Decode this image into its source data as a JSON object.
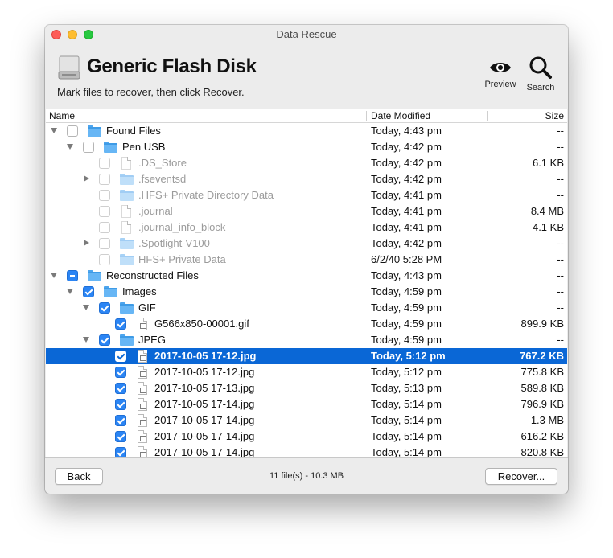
{
  "window": {
    "title": "Data Rescue"
  },
  "header": {
    "disk_title": "Generic Flash Disk",
    "subtitle": "Mark files to recover, then click Recover.",
    "preview_label": "Preview",
    "search_label": "Search"
  },
  "columns": {
    "name": "Name",
    "date": "Date Modified",
    "size": "Size"
  },
  "rows": [
    {
      "name": "Found Files",
      "date": "Today, 4:43 pm",
      "size": "--"
    },
    {
      "name": "Pen USB",
      "date": "Today, 4:42 pm",
      "size": "--"
    },
    {
      "name": ".DS_Store",
      "date": "Today, 4:42 pm",
      "size": "6.1 KB"
    },
    {
      "name": ".fseventsd",
      "date": "Today, 4:42 pm",
      "size": "--"
    },
    {
      "name": ".HFS+ Private Directory Data",
      "date": "Today, 4:41 pm",
      "size": "--"
    },
    {
      "name": ".journal",
      "date": "Today, 4:41 pm",
      "size": "8.4 MB"
    },
    {
      "name": ".journal_info_block",
      "date": "Today, 4:41 pm",
      "size": "4.1 KB"
    },
    {
      "name": ".Spotlight-V100",
      "date": "Today, 4:42 pm",
      "size": "--"
    },
    {
      "name": "HFS+ Private Data",
      "date": "6/2/40 5:28 PM",
      "size": "--"
    },
    {
      "name": "Reconstructed Files",
      "date": "Today, 4:43 pm",
      "size": "--"
    },
    {
      "name": "Images",
      "date": "Today, 4:59 pm",
      "size": "--"
    },
    {
      "name": "GIF",
      "date": "Today, 4:59 pm",
      "size": "--"
    },
    {
      "name": "G566x850-00001.gif",
      "date": "Today, 4:59 pm",
      "size": "899.9 KB"
    },
    {
      "name": "JPEG",
      "date": "Today, 4:59 pm",
      "size": "--"
    },
    {
      "name": "2017-10-05 17-12.jpg",
      "date": "Today, 5:12 pm",
      "size": "767.2 KB"
    },
    {
      "name": "2017-10-05 17-12.jpg",
      "date": "Today, 5:12 pm",
      "size": "775.8 KB"
    },
    {
      "name": "2017-10-05 17-13.jpg",
      "date": "Today, 5:13 pm",
      "size": "589.8 KB"
    },
    {
      "name": "2017-10-05 17-14.jpg",
      "date": "Today, 5:14 pm",
      "size": "796.9 KB"
    },
    {
      "name": "2017-10-05 17-14.jpg",
      "date": "Today, 5:14 pm",
      "size": "1.3 MB"
    },
    {
      "name": "2017-10-05 17-14.jpg",
      "date": "Today, 5:14 pm",
      "size": "616.2 KB"
    },
    {
      "name": "2017-10-05 17-14.jpg",
      "date": "Today, 5:14 pm",
      "size": "820.8 KB"
    }
  ],
  "footer": {
    "back_label": "Back",
    "status": "11 file(s) - 10.3 MB",
    "recover_label": "Recover..."
  },
  "colors": {
    "selection": "#0a67d6",
    "checkbox": "#2b85f4",
    "folder": "#67b6f5"
  },
  "icons": {
    "disk": "hard-drive-icon",
    "preview": "eye-icon",
    "search": "magnifier-icon"
  }
}
